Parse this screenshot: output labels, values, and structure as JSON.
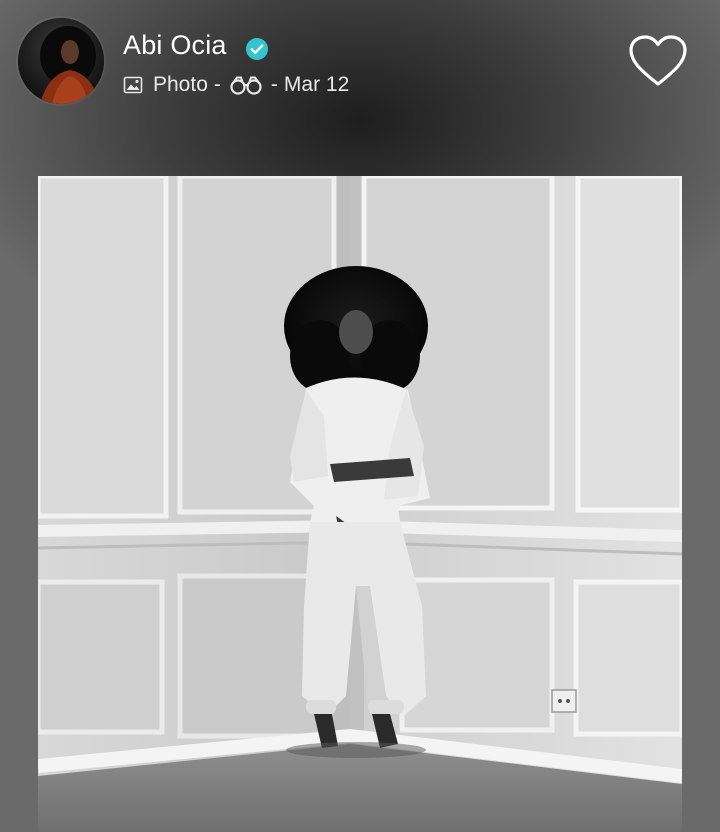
{
  "author": {
    "name": "Abi Ocia",
    "verified": true,
    "verified_color": "#33c5cf",
    "avatar_icon": "avatar"
  },
  "meta": {
    "type_icon": "photo-icon",
    "type_label": "Photo",
    "separator": "-",
    "audience_icon": "binoculars-icon",
    "date": "Mar 12"
  },
  "actions": {
    "like_icon": "heart-outline-icon"
  },
  "post": {
    "image_subject": "black-and-white photo"
  }
}
